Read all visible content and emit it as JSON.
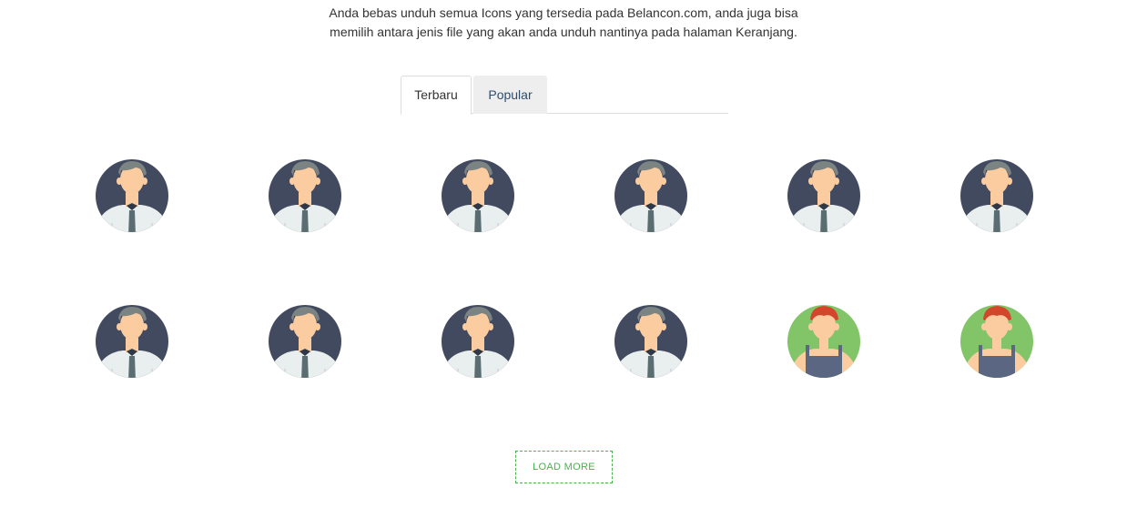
{
  "intro": {
    "line1": "Anda bebas unduh semua Icons yang tersedia pada Belancon.com, anda juga bisa",
    "line2": "memilih antara jenis file yang akan anda unduh nantinya pada halaman Keranjang."
  },
  "tabs": [
    {
      "label": "Terbaru",
      "active": true
    },
    {
      "label": "Popular",
      "active": false
    }
  ],
  "icons": [
    {
      "name": "businessman-icon",
      "type": "businessman"
    },
    {
      "name": "businessman-icon",
      "type": "businessman"
    },
    {
      "name": "businessman-icon",
      "type": "businessman"
    },
    {
      "name": "businessman-icon",
      "type": "businessman"
    },
    {
      "name": "businessman-icon",
      "type": "businessman"
    },
    {
      "name": "businessman-icon",
      "type": "businessman"
    },
    {
      "name": "businessman-icon",
      "type": "businessman"
    },
    {
      "name": "businessman-icon",
      "type": "businessman"
    },
    {
      "name": "businessman-icon",
      "type": "businessman"
    },
    {
      "name": "businessman-icon",
      "type": "businessman"
    },
    {
      "name": "worker-overalls-icon",
      "type": "worker"
    },
    {
      "name": "worker-overalls-icon",
      "type": "worker"
    }
  ],
  "colors": {
    "businessman_bg": "#414a5e",
    "worker_bg": "#82c468",
    "skin": "#fccca1",
    "hair_gray": "#7c8483",
    "hair_red": "#d3462c",
    "shirt": "#e9eeef",
    "tie": "#5a6e72",
    "overalls": "#5a6682",
    "accent_green": "#4caf50"
  },
  "load_more_label": "LOAD MORE"
}
